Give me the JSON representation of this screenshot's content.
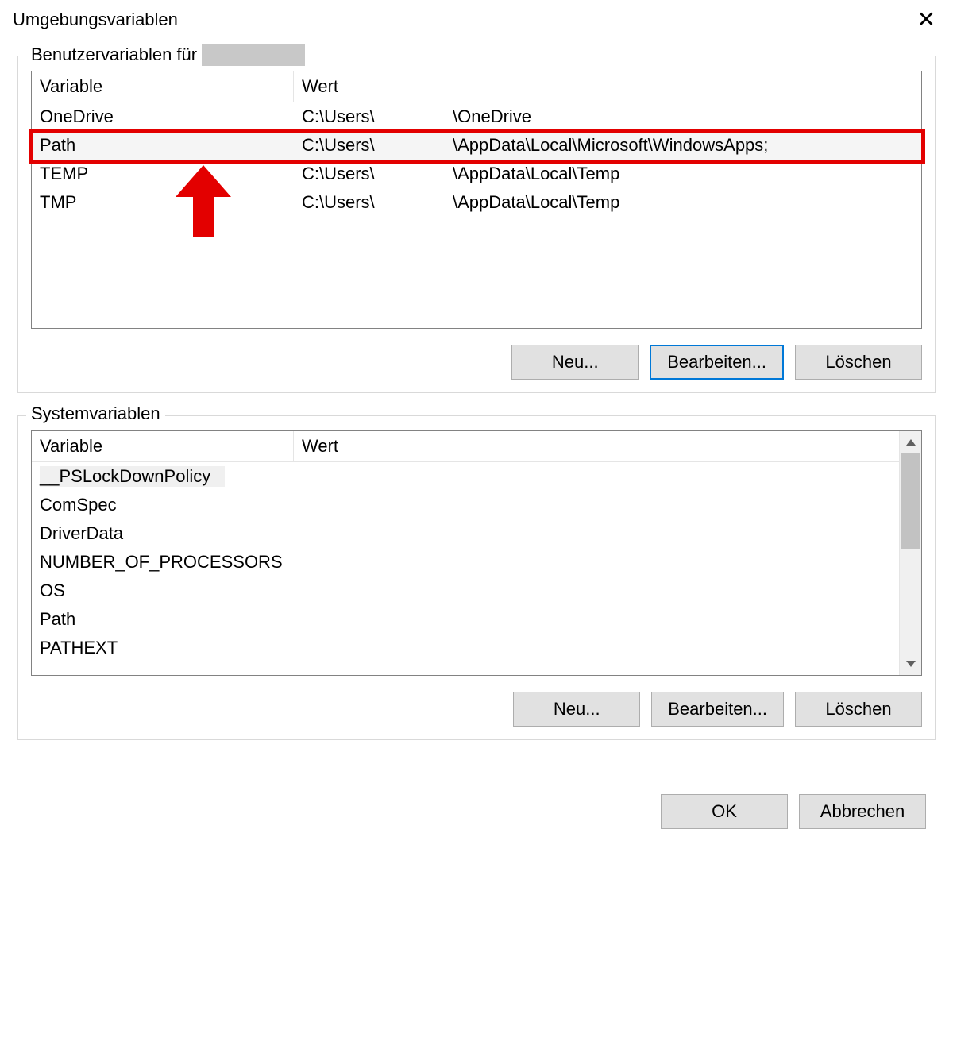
{
  "title": "Umgebungsvariablen",
  "user_section": {
    "legend_prefix": "Benutzervariablen für",
    "columns": {
      "variable": "Variable",
      "value": "Wert"
    },
    "rows": [
      {
        "name": "OneDrive",
        "value_prefix": "C:\\Users\\",
        "value_suffix": "\\OneDrive",
        "selected": false,
        "highlight": false
      },
      {
        "name": "Path",
        "value_prefix": "C:\\Users\\",
        "value_suffix": "\\AppData\\Local\\Microsoft\\WindowsApps;",
        "selected": true,
        "highlight": true
      },
      {
        "name": "TEMP",
        "value_prefix": "C:\\Users\\",
        "value_suffix": "\\AppData\\Local\\Temp",
        "selected": false,
        "highlight": false
      },
      {
        "name": "TMP",
        "value_prefix": "C:\\Users\\",
        "value_suffix": "\\AppData\\Local\\Temp",
        "selected": false,
        "highlight": false
      }
    ],
    "buttons": {
      "new": "Neu...",
      "edit": "Bearbeiten...",
      "delete": "Löschen"
    }
  },
  "system_section": {
    "legend": "Systemvariablen",
    "columns": {
      "variable": "Variable",
      "value": "Wert"
    },
    "rows": [
      {
        "name": "__PSLockDownPolicy",
        "value": "",
        "selected": true
      },
      {
        "name": "ComSpec",
        "value": "",
        "selected": false
      },
      {
        "name": "DriverData",
        "value": "",
        "selected": false
      },
      {
        "name": "NUMBER_OF_PROCESSORS",
        "value": "",
        "selected": false
      },
      {
        "name": "OS",
        "value": "",
        "selected": false
      },
      {
        "name": "Path",
        "value": "",
        "selected": false
      },
      {
        "name": "PATHEXT",
        "value": "",
        "selected": false
      }
    ],
    "buttons": {
      "new": "Neu...",
      "edit": "Bearbeiten...",
      "delete": "Löschen"
    }
  },
  "footer": {
    "ok": "OK",
    "cancel": "Abbrechen"
  },
  "annotation": {
    "highlight_color": "#e30000"
  }
}
